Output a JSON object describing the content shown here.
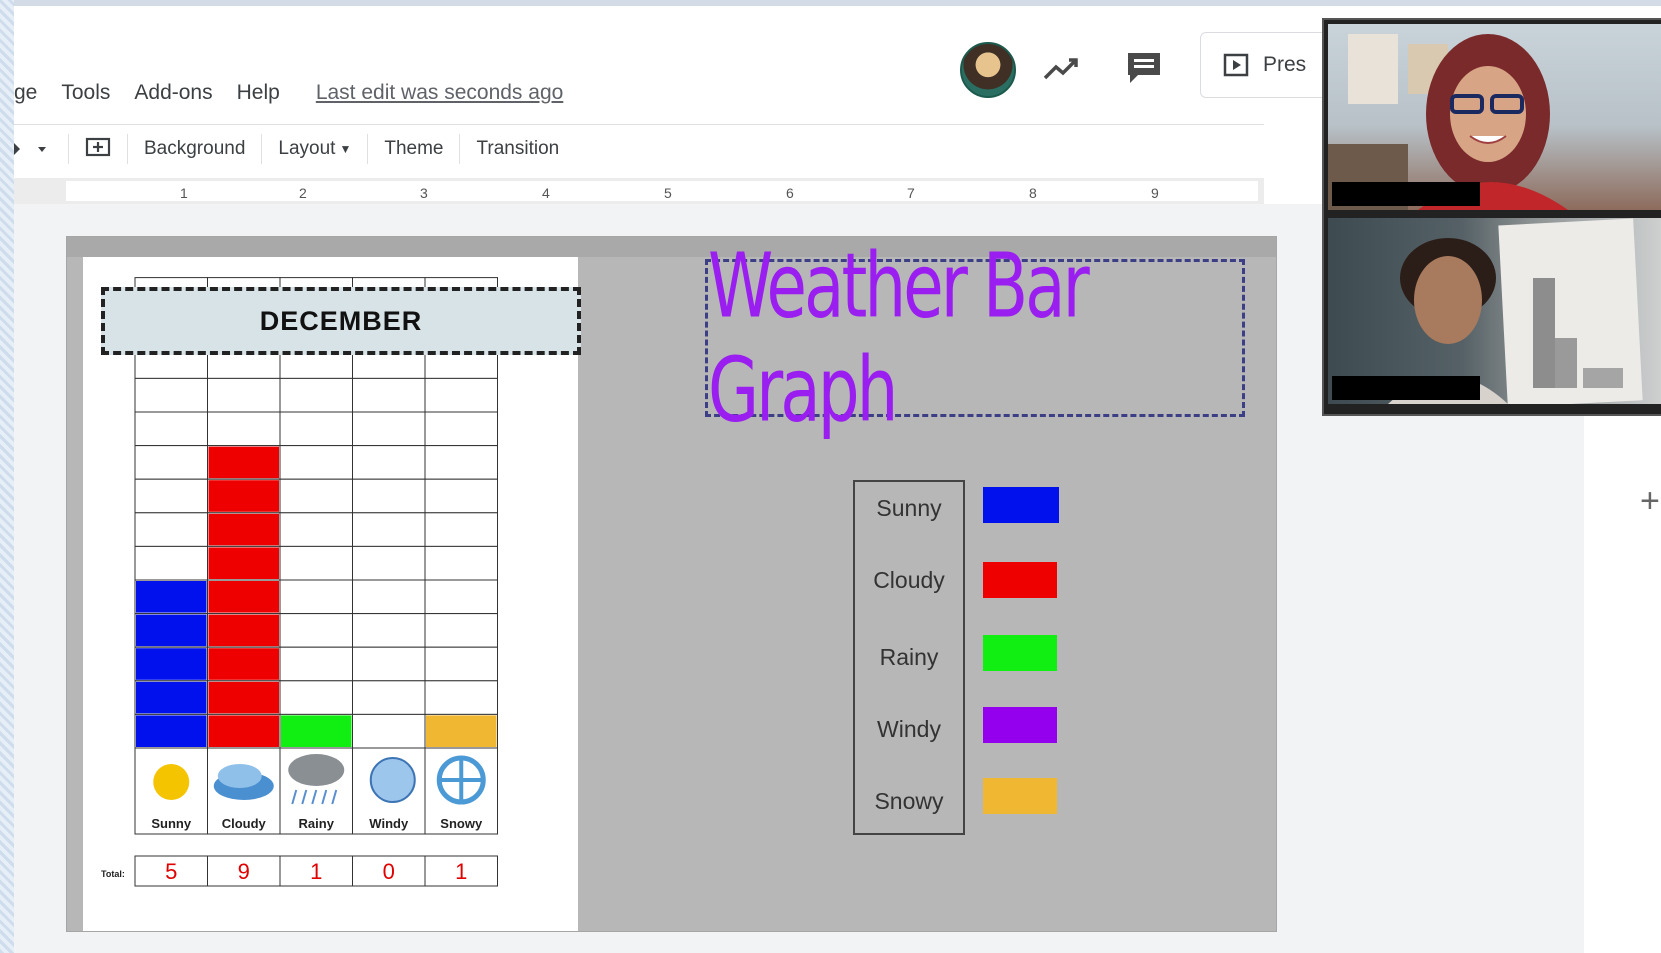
{
  "menu": {
    "items": [
      "ge",
      "Tools",
      "Add-ons",
      "Help"
    ],
    "last_edit": "Last edit was seconds ago"
  },
  "header": {
    "present_label": "Pres"
  },
  "toolbar": {
    "background": "Background",
    "layout": "Layout",
    "theme": "Theme",
    "transition": "Transition"
  },
  "ruler": {
    "marks": [
      "1",
      "2",
      "3",
      "4",
      "5",
      "6",
      "7",
      "8",
      "9"
    ]
  },
  "slide": {
    "title": "Weather Bar Graph",
    "month": "DECEMBER",
    "totals_label": "Total:",
    "legend": [
      {
        "label": "Sunny",
        "color": "#0011ee"
      },
      {
        "label": "Cloudy",
        "color": "#ee0000"
      },
      {
        "label": "Rainy",
        "color": "#11ee11"
      },
      {
        "label": "Windy",
        "color": "#9400ee"
      },
      {
        "label": "Snowy",
        "color": "#f0b832"
      }
    ]
  },
  "chart_data": {
    "type": "bar",
    "categories": [
      "Sunny",
      "Cloudy",
      "Rainy",
      "Windy",
      "Snowy"
    ],
    "values": [
      5,
      9,
      1,
      0,
      1
    ],
    "colors": [
      "#0011ee",
      "#ee0000",
      "#11ee11",
      "#9400ee",
      "#f0b832"
    ],
    "title": "DECEMBER",
    "ylim": [
      0,
      14
    ],
    "grid": true
  },
  "icons": {
    "trend": "trending-up-icon",
    "comment": "comment-icon",
    "present": "present-icon",
    "add": "plus-icon"
  }
}
